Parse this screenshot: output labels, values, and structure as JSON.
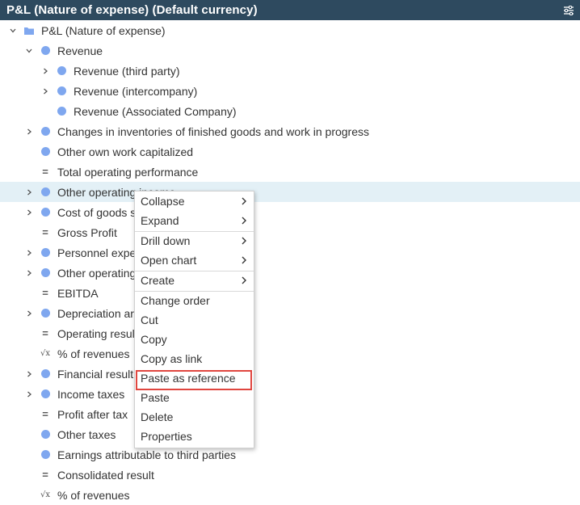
{
  "panel": {
    "title": "P&L (Nature of expense) (Default currency)",
    "settings_icon": "sliders-icon"
  },
  "tree": {
    "root": {
      "label": "P&L (Nature of expense)",
      "icon": "folder-icon"
    },
    "items": [
      {
        "label": "Revenue",
        "icon": "dot",
        "toggle": "expanded"
      },
      {
        "label": "Revenue (third party)",
        "icon": "dot",
        "toggle": "collapsed"
      },
      {
        "label": "Revenue (intercompany)",
        "icon": "dot",
        "toggle": "collapsed"
      },
      {
        "label": "Revenue (Associated Company)",
        "icon": "dot",
        "toggle": "none"
      },
      {
        "label": "Changes in inventories of finished goods and work in progress",
        "icon": "dot",
        "toggle": "collapsed"
      },
      {
        "label": "Other own work capitalized",
        "icon": "dot",
        "toggle": "none"
      },
      {
        "label": "Total operating performance",
        "icon": "equals",
        "toggle": "none"
      },
      {
        "label": "Other operating income",
        "icon": "dot",
        "toggle": "collapsed",
        "selected": true
      },
      {
        "label": "Cost of goods s",
        "icon": "dot",
        "toggle": "collapsed"
      },
      {
        "label": "Gross Profit",
        "icon": "equals",
        "toggle": "none"
      },
      {
        "label": "Personnel expe",
        "icon": "dot",
        "toggle": "collapsed"
      },
      {
        "label": "Other operating",
        "icon": "dot",
        "toggle": "collapsed"
      },
      {
        "label": "EBITDA",
        "icon": "equals",
        "toggle": "none"
      },
      {
        "label": "Depreciation ar",
        "icon": "dot",
        "toggle": "collapsed"
      },
      {
        "label": "Operating resul",
        "icon": "equals",
        "toggle": "none"
      },
      {
        "label": "% of revenues",
        "icon": "formula",
        "toggle": "none"
      },
      {
        "label": "Financial result",
        "icon": "dot",
        "toggle": "collapsed"
      },
      {
        "label": "Income taxes",
        "icon": "dot",
        "toggle": "collapsed"
      },
      {
        "label": "Profit after tax",
        "icon": "equals",
        "toggle": "none"
      },
      {
        "label": "Other taxes",
        "icon": "dot",
        "toggle": "none"
      },
      {
        "label": "Earnings attributable to third parties",
        "icon": "dot",
        "toggle": "none"
      },
      {
        "label": "Consolidated result",
        "icon": "equals",
        "toggle": "none"
      },
      {
        "label": "% of revenues",
        "icon": "formula",
        "toggle": "none"
      }
    ]
  },
  "context_menu": {
    "items": [
      {
        "label": "Collapse",
        "submenu": true
      },
      {
        "label": "Expand",
        "submenu": true
      },
      {
        "label": "Drill down",
        "submenu": true
      },
      {
        "label": "Open chart",
        "submenu": true
      },
      {
        "label": "Create",
        "submenu": true
      },
      {
        "label": "Change order",
        "submenu": false
      },
      {
        "label": "Cut",
        "submenu": false
      },
      {
        "label": "Copy",
        "submenu": false
      },
      {
        "label": "Copy as link",
        "submenu": false
      },
      {
        "label": "Paste as reference",
        "submenu": false,
        "highlighted": true
      },
      {
        "label": "Paste",
        "submenu": false
      },
      {
        "label": "Delete",
        "submenu": false
      },
      {
        "label": "Properties",
        "submenu": false
      }
    ]
  },
  "colors": {
    "header_bg": "#2e4a5f",
    "dot": "#7fa7ef",
    "folder": "#7fa7ef",
    "selected_row": "#e3f0f6",
    "highlight_border": "#e0463f"
  }
}
